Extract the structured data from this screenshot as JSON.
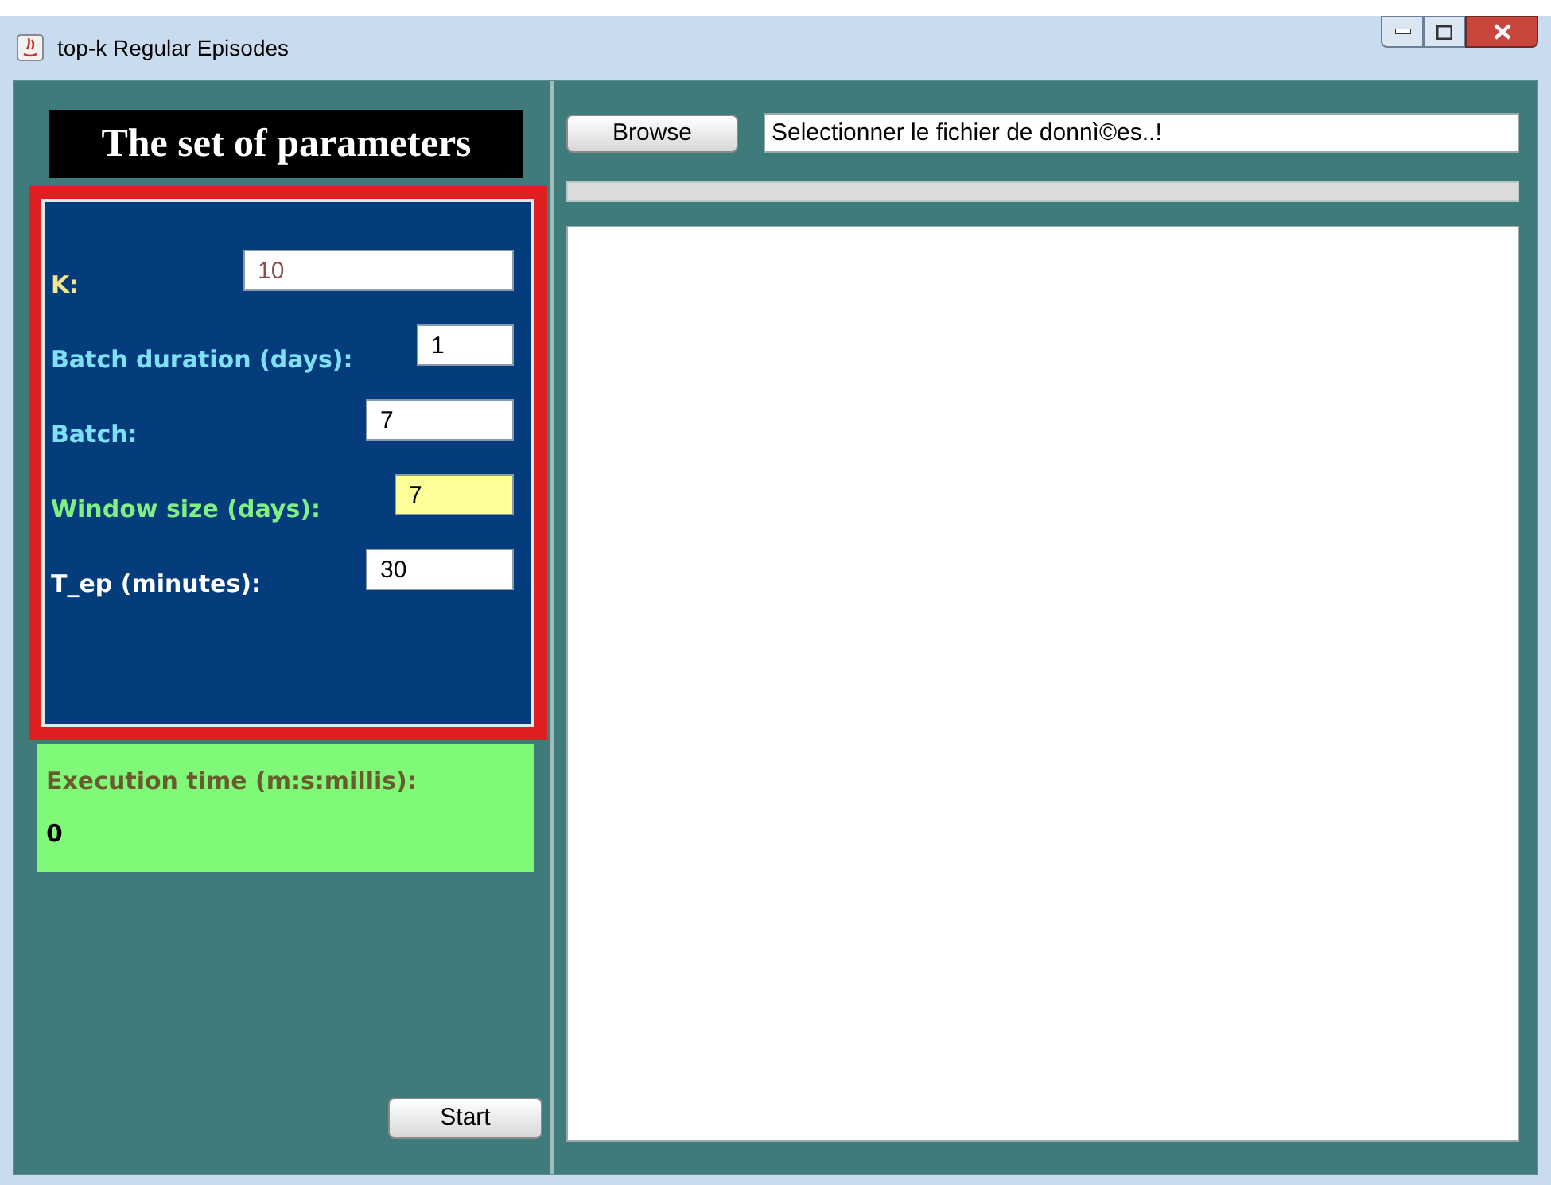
{
  "window": {
    "title": "top-k Regular Episodes"
  },
  "parameters": {
    "title": "The set of parameters",
    "outlined": true,
    "fields": [
      {
        "label": "K:",
        "value": "10",
        "color": "#f0e68c",
        "highlighted": false
      },
      {
        "label": "Batch duration (days):",
        "value": "1",
        "color": "#7fe0f5",
        "highlighted": false
      },
      {
        "label": "Batch:",
        "value": "7",
        "color": "#7fe0f5",
        "highlighted": false
      },
      {
        "label": "Window size (days):",
        "value": "7",
        "color": "#80f080",
        "highlighted": true
      },
      {
        "label": "T_ep (minutes):",
        "value": "30",
        "color": "#ffffff",
        "highlighted": false
      }
    ]
  },
  "execution": {
    "label": "Execution time (m:s:millis):",
    "value": "0"
  },
  "start_button": "Start",
  "browse_button": "Browse",
  "file_field": {
    "value": "Selectionner le fichier de donnì©es..!"
  }
}
